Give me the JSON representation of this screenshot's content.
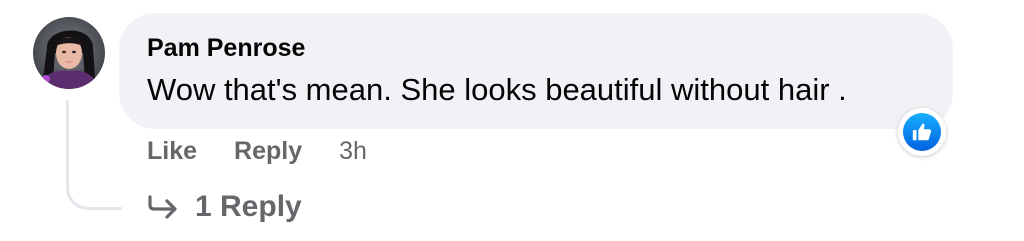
{
  "comment": {
    "author": "Pam Penrose",
    "text": "Wow that's mean. She looks beautiful without hair .",
    "avatar_icon": "user-avatar-photo",
    "reaction_icon": "thumbs-up-icon",
    "reaction_color": "#1b74e4"
  },
  "actions": {
    "like_label": "Like",
    "reply_label": "Reply",
    "timestamp": "3h"
  },
  "replies": {
    "icon": "reply-arrow-icon",
    "label": "1 Reply"
  },
  "colors": {
    "bubble": "#f0f2f5",
    "secondary_text": "#65676b",
    "primary_text": "#050505",
    "thread_line": "#e4e6eb"
  }
}
